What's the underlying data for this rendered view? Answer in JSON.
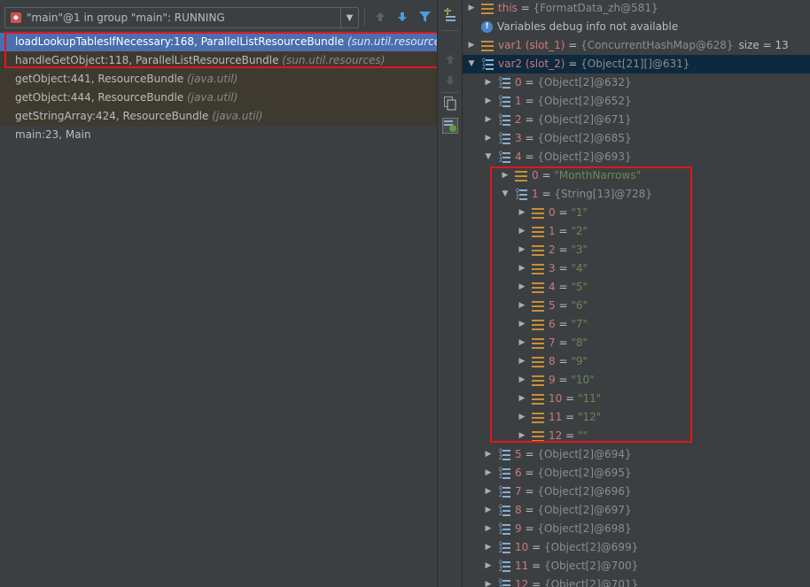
{
  "thread_selector": {
    "label": "\"main\"@1 in group \"main\": RUNNING",
    "dropdown_glyph": "▼"
  },
  "frames": [
    {
      "method": "loadLookupTablesIfNecessary:168, ParallelListResourceBundle",
      "package": "(sun.util.resources)",
      "selected": true,
      "library": false
    },
    {
      "method": "handleGetObject:118, ParallelListResourceBundle",
      "package": "(sun.util.resources)",
      "selected": false,
      "library": true
    },
    {
      "method": "getObject:441, ResourceBundle",
      "package": "(java.util)",
      "selected": false,
      "library": true
    },
    {
      "method": "getObject:444, ResourceBundle",
      "package": "(java.util)",
      "selected": false,
      "library": true
    },
    {
      "method": "getStringArray:424, ResourceBundle",
      "package": "(java.util)",
      "selected": false,
      "library": true
    },
    {
      "method": "main:23, Main",
      "package": "",
      "selected": false,
      "library": false
    }
  ],
  "variables": [
    {
      "indent": 0,
      "toggle": "collapsed",
      "icon": "field-icon",
      "name": "this",
      "value": "{FormatData_zh@581}",
      "vtype": "ref",
      "extra": ""
    },
    {
      "indent": 0,
      "toggle": "none",
      "icon": "info-icon",
      "name": "",
      "value": "Variables debug info not available",
      "vtype": "plain",
      "extra": ""
    },
    {
      "indent": 0,
      "toggle": "collapsed",
      "icon": "field-icon",
      "name": "var1 (slot_1)",
      "value": "{ConcurrentHashMap@628}",
      "vtype": "ref",
      "extra": "size = 13"
    },
    {
      "indent": 0,
      "toggle": "expanded",
      "icon": "array-icon",
      "name": "var2 (slot_2)",
      "value": "{Object[21][]@631}",
      "vtype": "ref",
      "extra": "",
      "selected": true
    },
    {
      "indent": 1,
      "toggle": "collapsed",
      "icon": "array-icon",
      "name": "0",
      "value": "{Object[2]@632}",
      "vtype": "ref",
      "extra": ""
    },
    {
      "indent": 1,
      "toggle": "collapsed",
      "icon": "array-icon",
      "name": "1",
      "value": "{Object[2]@652}",
      "vtype": "ref",
      "extra": ""
    },
    {
      "indent": 1,
      "toggle": "collapsed",
      "icon": "array-icon",
      "name": "2",
      "value": "{Object[2]@671}",
      "vtype": "ref",
      "extra": ""
    },
    {
      "indent": 1,
      "toggle": "collapsed",
      "icon": "array-icon",
      "name": "3",
      "value": "{Object[2]@685}",
      "vtype": "ref",
      "extra": ""
    },
    {
      "indent": 1,
      "toggle": "expanded",
      "icon": "array-icon",
      "name": "4",
      "value": "{Object[2]@693}",
      "vtype": "ref",
      "extra": ""
    },
    {
      "indent": 2,
      "toggle": "collapsed",
      "icon": "field-icon",
      "name": "0",
      "value": "\"MonthNarrows\"",
      "vtype": "str",
      "extra": ""
    },
    {
      "indent": 2,
      "toggle": "expanded",
      "icon": "array-icon",
      "name": "1",
      "value": "{String[13]@728}",
      "vtype": "ref",
      "extra": ""
    },
    {
      "indent": 3,
      "toggle": "collapsed",
      "icon": "field-icon",
      "name": "0",
      "value": "\"1\"",
      "vtype": "str",
      "extra": ""
    },
    {
      "indent": 3,
      "toggle": "collapsed",
      "icon": "field-icon",
      "name": "1",
      "value": "\"2\"",
      "vtype": "str",
      "extra": ""
    },
    {
      "indent": 3,
      "toggle": "collapsed",
      "icon": "field-icon",
      "name": "2",
      "value": "\"3\"",
      "vtype": "str",
      "extra": ""
    },
    {
      "indent": 3,
      "toggle": "collapsed",
      "icon": "field-icon",
      "name": "3",
      "value": "\"4\"",
      "vtype": "str",
      "extra": ""
    },
    {
      "indent": 3,
      "toggle": "collapsed",
      "icon": "field-icon",
      "name": "4",
      "value": "\"5\"",
      "vtype": "str",
      "extra": ""
    },
    {
      "indent": 3,
      "toggle": "collapsed",
      "icon": "field-icon",
      "name": "5",
      "value": "\"6\"",
      "vtype": "str",
      "extra": ""
    },
    {
      "indent": 3,
      "toggle": "collapsed",
      "icon": "field-icon",
      "name": "6",
      "value": "\"7\"",
      "vtype": "str",
      "extra": ""
    },
    {
      "indent": 3,
      "toggle": "collapsed",
      "icon": "field-icon",
      "name": "7",
      "value": "\"8\"",
      "vtype": "str",
      "extra": ""
    },
    {
      "indent": 3,
      "toggle": "collapsed",
      "icon": "field-icon",
      "name": "8",
      "value": "\"9\"",
      "vtype": "str",
      "extra": ""
    },
    {
      "indent": 3,
      "toggle": "collapsed",
      "icon": "field-icon",
      "name": "9",
      "value": "\"10\"",
      "vtype": "str",
      "extra": ""
    },
    {
      "indent": 3,
      "toggle": "collapsed",
      "icon": "field-icon",
      "name": "10",
      "value": "\"11\"",
      "vtype": "str",
      "extra": ""
    },
    {
      "indent": 3,
      "toggle": "collapsed",
      "icon": "field-icon",
      "name": "11",
      "value": "\"12\"",
      "vtype": "str",
      "extra": ""
    },
    {
      "indent": 3,
      "toggle": "collapsed",
      "icon": "field-icon",
      "name": "12",
      "value": "\"\"",
      "vtype": "str",
      "extra": ""
    },
    {
      "indent": 1,
      "toggle": "collapsed",
      "icon": "array-icon",
      "name": "5",
      "value": "{Object[2]@694}",
      "vtype": "ref",
      "extra": ""
    },
    {
      "indent": 1,
      "toggle": "collapsed",
      "icon": "array-icon",
      "name": "6",
      "value": "{Object[2]@695}",
      "vtype": "ref",
      "extra": ""
    },
    {
      "indent": 1,
      "toggle": "collapsed",
      "icon": "array-icon",
      "name": "7",
      "value": "{Object[2]@696}",
      "vtype": "ref",
      "extra": ""
    },
    {
      "indent": 1,
      "toggle": "collapsed",
      "icon": "array-icon",
      "name": "8",
      "value": "{Object[2]@697}",
      "vtype": "ref",
      "extra": ""
    },
    {
      "indent": 1,
      "toggle": "collapsed",
      "icon": "array-icon",
      "name": "9",
      "value": "{Object[2]@698}",
      "vtype": "ref",
      "extra": ""
    },
    {
      "indent": 1,
      "toggle": "collapsed",
      "icon": "array-icon",
      "name": "10",
      "value": "{Object[2]@699}",
      "vtype": "ref",
      "extra": ""
    },
    {
      "indent": 1,
      "toggle": "collapsed",
      "icon": "array-icon",
      "name": "11",
      "value": "{Object[2]@700}",
      "vtype": "ref",
      "extra": ""
    },
    {
      "indent": 1,
      "toggle": "collapsed",
      "icon": "array-icon",
      "name": "12",
      "value": "{Object[2]@701}",
      "vtype": "ref",
      "extra": ""
    }
  ],
  "colors": {
    "panel_bg": "#3c3f41",
    "selection": "#4b6eaf",
    "var_selection": "#0d293e",
    "highlight_box": "#e0161e",
    "var_name": "#cc7a7a",
    "string_value": "#6a8759"
  }
}
